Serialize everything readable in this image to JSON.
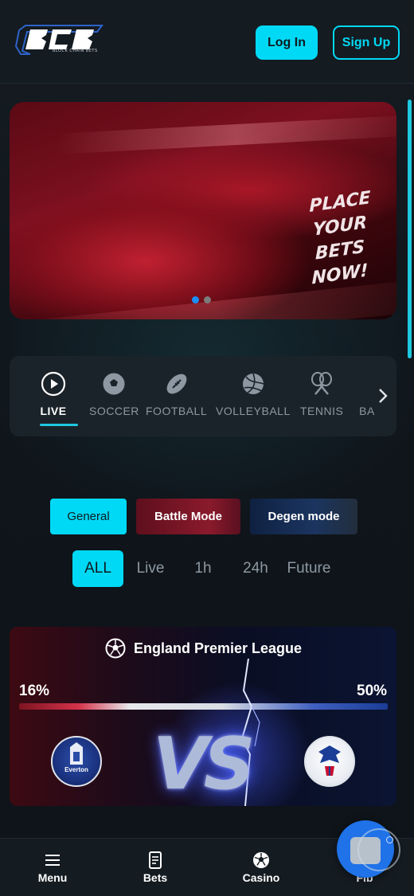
{
  "header": {
    "logo_text": "BCB",
    "logo_tagline": "BLOCK CHAIN BETS",
    "login_label": "Log In",
    "signup_label": "Sign Up"
  },
  "banner": {
    "headline_line1": "PLACE YOUR",
    "headline_line2": "BETS NOW!",
    "slides_total": 2,
    "active_slide": 1
  },
  "sports": {
    "items": [
      {
        "label": "LIVE",
        "icon": "play-circle-icon",
        "active": true
      },
      {
        "label": "SOCCER",
        "icon": "soccer-ball-icon"
      },
      {
        "label": "FOOTBALL",
        "icon": "american-football-icon"
      },
      {
        "label": "VOLLEYBALL",
        "icon": "volleyball-icon"
      },
      {
        "label": "TENNIS",
        "icon": "tennis-rackets-icon"
      },
      {
        "label": "BA",
        "icon": "basketball-icon"
      }
    ],
    "next_icon": "chevron-right-icon"
  },
  "modes": {
    "general": "General",
    "battle": "Battle Mode",
    "degen": "Degen mode",
    "selected": "General"
  },
  "time_filters": {
    "all": "ALL",
    "live": "Live",
    "h1": "1h",
    "h24": "24h",
    "future": "Future",
    "selected": "ALL"
  },
  "match": {
    "league": "England Premier League",
    "league_icon": "soccer-ball-icon",
    "home_pct": "16%",
    "away_pct": "50%",
    "home_crest_text": "Everton",
    "vs_text": "VS"
  },
  "bottom_nav": {
    "menu": "Menu",
    "bets": "Bets",
    "casino": "Casino",
    "fourth": "Fib"
  },
  "colors": {
    "accent": "#00d9f5",
    "background": "#11171d",
    "battle": "#8a1a2c",
    "degen": "#1b3560",
    "fab": "#1f72e8"
  }
}
